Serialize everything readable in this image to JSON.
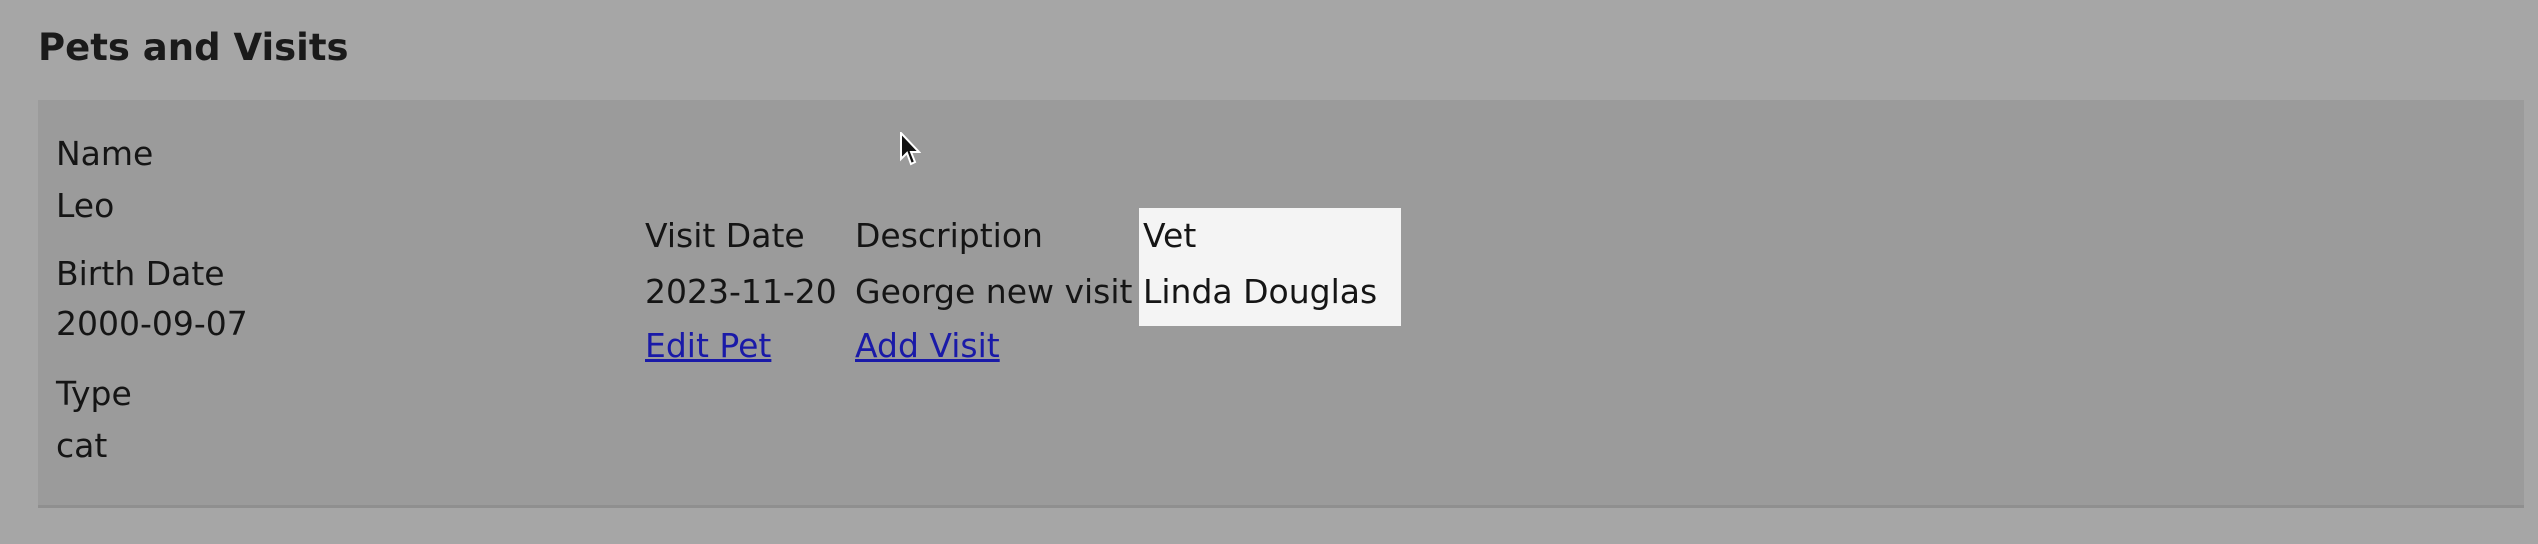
{
  "section": {
    "title": "Pets and Visits"
  },
  "pet": {
    "name_label": "Name",
    "name": "Leo",
    "birth_date_label": "Birth Date",
    "birth_date": "2000-09-07",
    "type_label": "Type",
    "type": "cat"
  },
  "visits": {
    "headers": {
      "visit_date": "Visit Date",
      "description": "Description",
      "vet": "Vet"
    },
    "rows": [
      {
        "visit_date": "2023-11-20",
        "description": "George new visit",
        "vet": "Linda Douglas"
      }
    ],
    "links": {
      "edit_pet": "Edit Pet",
      "add_visit": "Add Visit"
    }
  },
  "colors": {
    "page_background": "#a6a6a6",
    "panel_background": "#9b9b9b",
    "highlight_background": "#f4f4f4",
    "link": "#1a1aa8"
  },
  "icons": {
    "cursor": "mouse-pointer-icon"
  }
}
